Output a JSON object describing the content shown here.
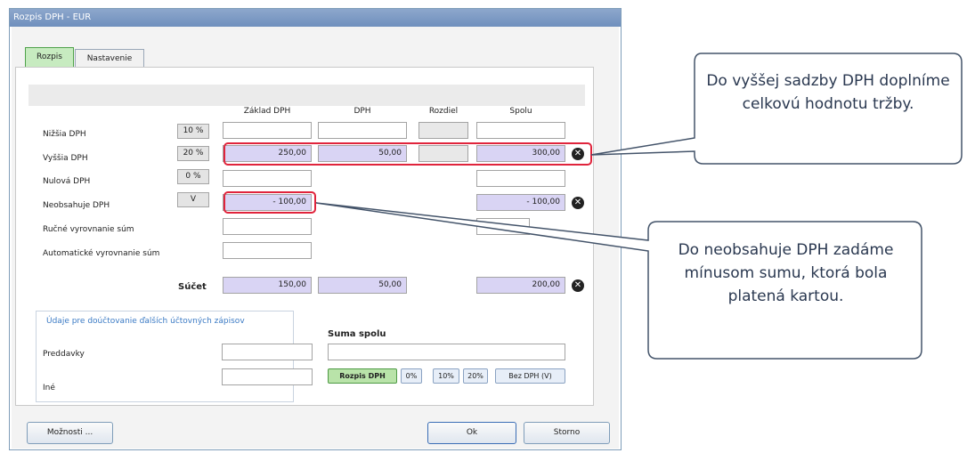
{
  "window": {
    "title": "Rozpis DPH - EUR"
  },
  "tabs": [
    {
      "label": "Rozpis"
    },
    {
      "label": "Nastavenie"
    }
  ],
  "columns": {
    "zaklad": "Základ DPH",
    "dph": "DPH",
    "rozdiel": "Rozdiel",
    "spolu": "Spolu"
  },
  "rows": {
    "nizsia": {
      "label": "Nižšia DPH",
      "rate": "10 %"
    },
    "vyssia": {
      "label": "Vyššia DPH",
      "rate": "20 %",
      "zaklad": "250,00",
      "dph": "50,00",
      "spolu": "300,00"
    },
    "nulova": {
      "label": "Nulová DPH",
      "rate": "0 %"
    },
    "neobsahuje": {
      "label": "Neobsahuje DPH",
      "rate": "V",
      "zaklad": "- 100,00",
      "spolu": "- 100,00"
    },
    "rucne": {
      "label": "Ručné vyrovnanie súm"
    },
    "automaticke": {
      "label": "Automatické vyrovnanie súm"
    },
    "sucet": {
      "label": "Súčet",
      "zaklad": "150,00",
      "dph": "50,00",
      "spolu": "200,00"
    }
  },
  "group": {
    "title": "Údaje pre doúčtovanie ďalších účtovných zápisov",
    "preddavky": "Preddavky",
    "ine": "Iné"
  },
  "suma": {
    "label": "Suma spolu"
  },
  "split_buttons": [
    {
      "label": "Rozpis DPH"
    },
    {
      "label": "0%"
    },
    {
      "label": "10%"
    },
    {
      "label": "20%"
    },
    {
      "label": "Bez DPH (V)"
    }
  ],
  "buttons": {
    "moznosti": "Možnosti ...",
    "ok": "Ok",
    "storno": "Storno"
  },
  "callouts": {
    "top": "Do vyššej sadzby DPH doplníme celkovú hodnotu tržby.",
    "bottom": "Do neobsahuje DPH zadáme mínusom sumu, ktorá bola platená kartou."
  },
  "colors": {
    "accent_tab": "#c7ebc0",
    "highlight": "#e0243c",
    "value_fill": "#d9d4f4",
    "callout_stroke": "#44546a"
  }
}
